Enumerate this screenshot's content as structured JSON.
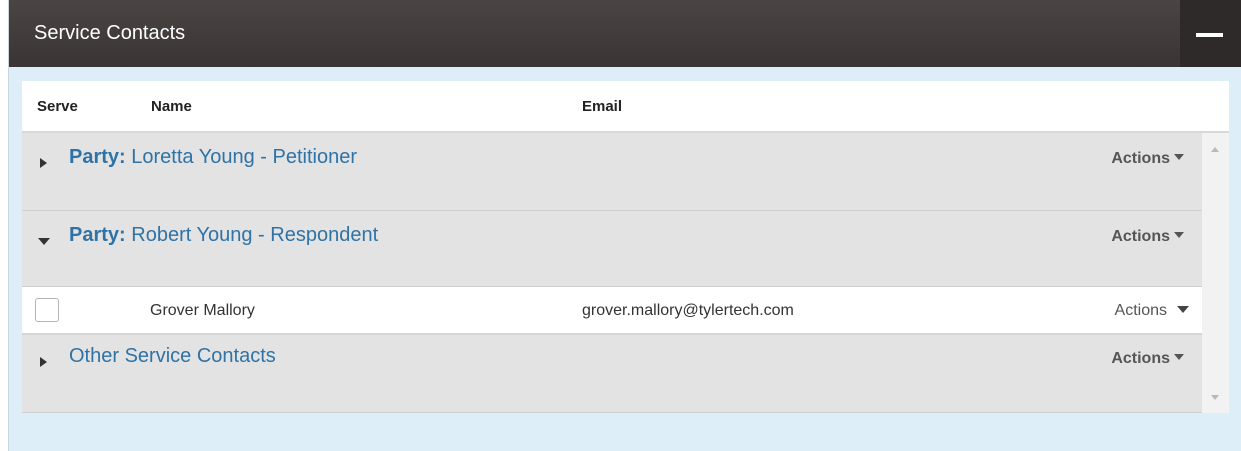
{
  "panel": {
    "title": "Service Contacts"
  },
  "table": {
    "headers": {
      "serve": "Serve",
      "name": "Name",
      "email": "Email"
    }
  },
  "groups": [
    {
      "prefix": "Party:",
      "title": "Loretta Young - Petitioner",
      "actions": "Actions",
      "expanded": false
    },
    {
      "prefix": "Party:",
      "title": "Robert Young - Respondent",
      "actions": "Actions",
      "expanded": true
    },
    {
      "prefix": "",
      "title": "Other Service Contacts",
      "actions": "Actions",
      "expanded": false
    }
  ],
  "contacts": [
    {
      "name": "Grover Mallory",
      "email": "grover.mallory@tylertech.com",
      "actions": "Actions",
      "checked": false
    }
  ],
  "colors": {
    "header_bg": "#3f3939",
    "panel_bg": "#ddeef8",
    "link": "#2f73a6",
    "group_bg": "#e3e3e3"
  },
  "icons": [
    "collapse-icon",
    "caret-right-icon",
    "caret-down-icon",
    "dropdown-triangle-icon",
    "scroll-up-arrow-icon",
    "scroll-down-arrow-icon"
  ]
}
